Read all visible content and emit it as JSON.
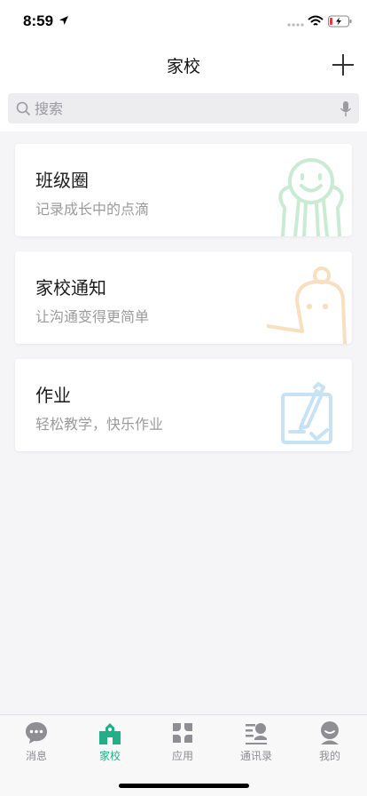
{
  "status_bar": {
    "time": "8:59"
  },
  "nav": {
    "title": "家校",
    "add_icon": "plus-icon"
  },
  "search": {
    "placeholder": "搜索",
    "search_icon": "search-icon",
    "mic_icon": "microphone-icon"
  },
  "cards": [
    {
      "title": "班级圈",
      "subtitle": "记录成长中的点滴",
      "accent": "#c9ebd4",
      "icon": "people-icon"
    },
    {
      "title": "家校通知",
      "subtitle": "让沟通变得更简单",
      "accent": "#f7dfbf",
      "icon": "bell-icon"
    },
    {
      "title": "作业",
      "subtitle": "轻松教学，快乐作业",
      "accent": "#c6e2f4",
      "icon": "homework-icon"
    }
  ],
  "tabs": [
    {
      "label": "消息",
      "icon": "chat-bubble-icon"
    },
    {
      "label": "家校",
      "icon": "school-icon",
      "active": true
    },
    {
      "label": "应用",
      "icon": "apps-grid-icon"
    },
    {
      "label": "通讯录",
      "icon": "contacts-icon"
    },
    {
      "label": "我的",
      "icon": "profile-icon"
    }
  ],
  "colors": {
    "active_tab": "#1fb088",
    "inactive_tab": "#8e8e93",
    "battery_low": "#e53935"
  }
}
